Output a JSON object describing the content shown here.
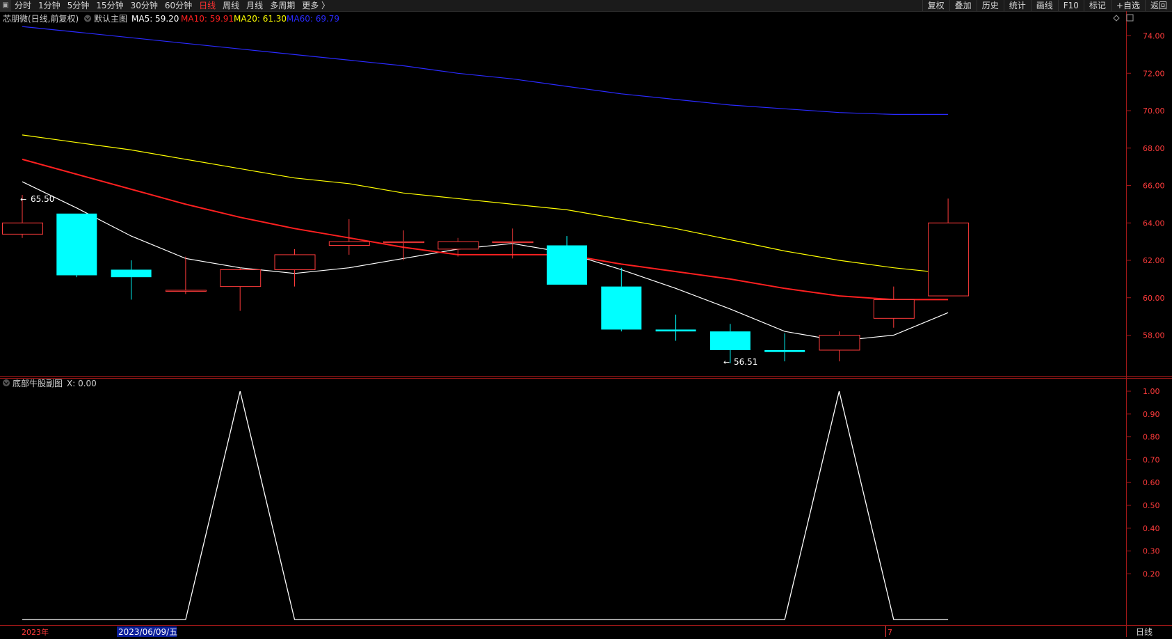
{
  "toolbar": {
    "corner_icon": "window-icon",
    "periods": [
      "分时",
      "1分钟",
      "5分钟",
      "15分钟",
      "30分钟",
      "60分钟",
      "日线",
      "周线",
      "月线",
      "多周期",
      "更多 〉"
    ],
    "active_period": "日线",
    "right_items": [
      "复权",
      "叠加",
      "历史",
      "统计",
      "画线",
      "F10",
      "标记",
      "+自选",
      "返回"
    ]
  },
  "main_panel": {
    "title": "芯朋微(日线,前复权)",
    "indicator_name": "默认主图",
    "ma_labels": [
      {
        "text": "MA5: 59.20",
        "color": "#ffffff"
      },
      {
        "text": "MA10: 59.91",
        "color": "#ff2020"
      },
      {
        "text": "MA20: 61.30",
        "color": "#ffff00"
      },
      {
        "text": "MA60: 69.79",
        "color": "#2a2aff"
      }
    ],
    "high_label": "65.50",
    "low_label": "56.51",
    "icons": [
      "diamond-icon",
      "square-icon"
    ]
  },
  "sub_panel": {
    "title": "底部牛股副图",
    "value_label": "X: 0.00"
  },
  "x_axis": {
    "year_label": "2023年",
    "cursor_date": "2023/06/09/五",
    "month_label": "7",
    "period_label": "日线"
  },
  "chart_data": [
    {
      "type": "candlestick",
      "title": "芯朋微(日线,前复权)",
      "ylim": [
        56.0,
        75.0
      ],
      "y_ticks": [
        "74.00",
        "72.00",
        "70.00",
        "68.00",
        "66.00",
        "64.00",
        "62.00",
        "60.00",
        "58.00"
      ],
      "candles": [
        {
          "open": 63.4,
          "close": 64.0,
          "high": 65.5,
          "low": 63.2
        },
        {
          "open": 64.5,
          "close": 61.2,
          "high": 64.5,
          "low": 61.1
        },
        {
          "open": 61.5,
          "close": 61.1,
          "high": 62.0,
          "low": 59.9
        },
        {
          "open": 60.4,
          "close": 60.4,
          "high": 62.2,
          "low": 60.2
        },
        {
          "open": 60.6,
          "close": 61.5,
          "high": 61.6,
          "low": 59.3
        },
        {
          "open": 61.5,
          "close": 62.3,
          "high": 62.6,
          "low": 60.6
        },
        {
          "open": 62.8,
          "close": 63.0,
          "high": 64.2,
          "low": 62.3
        },
        {
          "open": 63.0,
          "close": 63.0,
          "high": 63.6,
          "low": 62.0
        },
        {
          "open": 62.6,
          "close": 63.0,
          "high": 63.2,
          "low": 62.2
        },
        {
          "open": 63.0,
          "close": 63.0,
          "high": 63.7,
          "low": 62.1
        },
        {
          "open": 62.8,
          "close": 60.7,
          "high": 63.3,
          "low": 60.7
        },
        {
          "open": 60.6,
          "close": 58.3,
          "high": 61.6,
          "low": 58.2
        },
        {
          "open": 58.3,
          "close": 58.2,
          "high": 59.1,
          "low": 57.7
        },
        {
          "open": 58.2,
          "close": 57.2,
          "high": 58.6,
          "low": 56.5
        },
        {
          "open": 57.2,
          "close": 57.1,
          "high": 58.1,
          "low": 56.6
        },
        {
          "open": 57.2,
          "close": 58.0,
          "high": 58.2,
          "low": 56.6
        },
        {
          "open": 58.9,
          "close": 59.9,
          "high": 60.6,
          "low": 58.4
        },
        {
          "open": 60.1,
          "close": 64.0,
          "high": 65.3,
          "low": 60.1
        }
      ],
      "ma_series": [
        {
          "name": "MA5",
          "color": "#ffffff",
          "values": [
            66.2,
            64.8,
            63.3,
            62.1,
            61.6,
            61.3,
            61.6,
            62.1,
            62.6,
            62.9,
            62.4,
            61.5,
            60.5,
            59.4,
            58.2,
            57.7,
            58.0,
            59.2
          ]
        },
        {
          "name": "MA10",
          "color": "#ff2020",
          "values": [
            67.4,
            66.6,
            65.8,
            65.0,
            64.3,
            63.7,
            63.2,
            62.7,
            62.3,
            62.3,
            62.3,
            61.8,
            61.4,
            61.0,
            60.5,
            60.1,
            59.9,
            59.9
          ]
        },
        {
          "name": "MA20",
          "color": "#ffff00",
          "values": [
            68.7,
            68.3,
            67.9,
            67.4,
            66.9,
            66.4,
            66.1,
            65.6,
            65.3,
            65.0,
            64.7,
            64.2,
            63.7,
            63.1,
            62.5,
            62.0,
            61.6,
            61.3
          ]
        },
        {
          "name": "MA60",
          "color": "#2a2aff",
          "values": [
            74.5,
            74.2,
            73.9,
            73.6,
            73.3,
            73.0,
            72.7,
            72.4,
            72.0,
            71.7,
            71.3,
            70.9,
            70.6,
            70.3,
            70.1,
            69.9,
            69.8,
            69.8
          ]
        }
      ]
    },
    {
      "type": "line",
      "title": "底部牛股副图",
      "ylim": [
        0.0,
        1.0
      ],
      "y_ticks": [
        "1.00",
        "0.90",
        "0.80",
        "0.70",
        "0.60",
        "0.50",
        "0.40",
        "0.30",
        "0.20"
      ],
      "series": [
        {
          "name": "X",
          "color": "#ffffff",
          "values": [
            0,
            0,
            0,
            0,
            1,
            0,
            0,
            0,
            0,
            0,
            0,
            0,
            0,
            0,
            0,
            1,
            0,
            0
          ]
        }
      ]
    }
  ]
}
